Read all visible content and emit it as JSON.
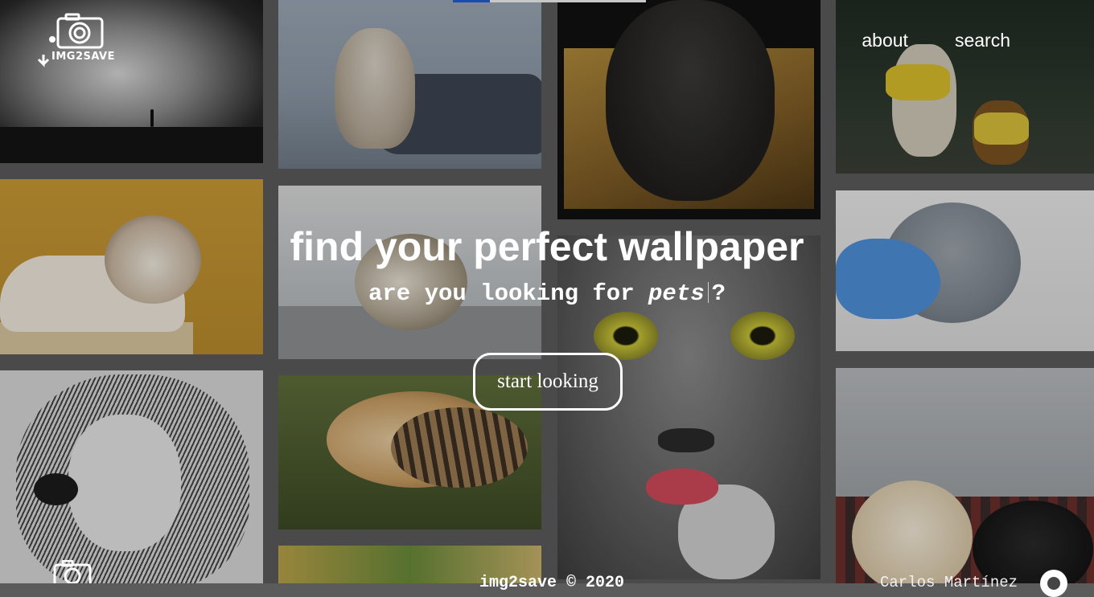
{
  "brand": {
    "logo_text": "IMG2SAVE"
  },
  "nav": {
    "items": [
      {
        "label": "about"
      },
      {
        "label": "search"
      }
    ]
  },
  "hero": {
    "title": "find your perfect wallpaper",
    "subtitle_prefix": "are you looking for",
    "subtitle_keyword": "pets",
    "subtitle_suffix": "?",
    "cta_label": "start looking"
  },
  "footer": {
    "copyright": "img2save © 2020",
    "author": "Carlos Martínez"
  },
  "icons": {
    "logo": "camera-download-icon",
    "footer_logo": "camera-icon",
    "github": "github-icon"
  },
  "colors": {
    "text": "#ffffff",
    "accent": "#1f5fd3",
    "overlay": "#000000"
  }
}
